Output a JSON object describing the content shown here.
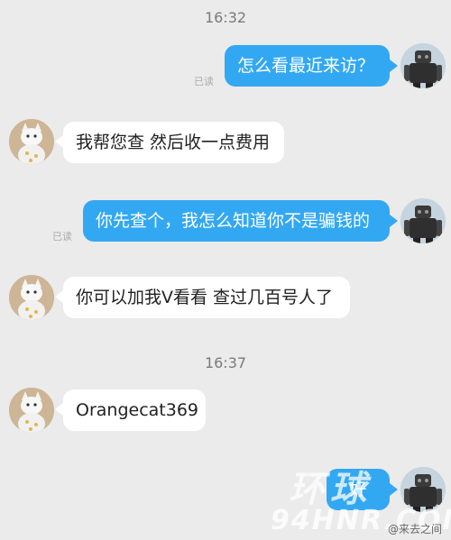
{
  "messages": {
    "time1": "16:32",
    "m1": {
      "text": "怎么看最近来访？",
      "read": "已读"
    },
    "m2": {
      "text": "我帮您查 然后收一点费用"
    },
    "m3": {
      "text": "你先查个，我怎么知道你不是骗钱的",
      "read": "已读"
    },
    "m4": {
      "text": "你可以加我V看看 查过几百号人了"
    },
    "time2": "16:37",
    "m5": {
      "text": "Orangecat369"
    },
    "m6": {
      "text": "好"
    }
  },
  "watermark": {
    "big": "环球",
    "url": "94HNR.COM",
    "weibo": "@来去之间"
  },
  "colors": {
    "outgoing_bubble": "#33a8f2",
    "incoming_bubble": "#ffffff",
    "background": "#ebebeb"
  },
  "icons": [
    "robot-avatar",
    "cat-avatar"
  ]
}
